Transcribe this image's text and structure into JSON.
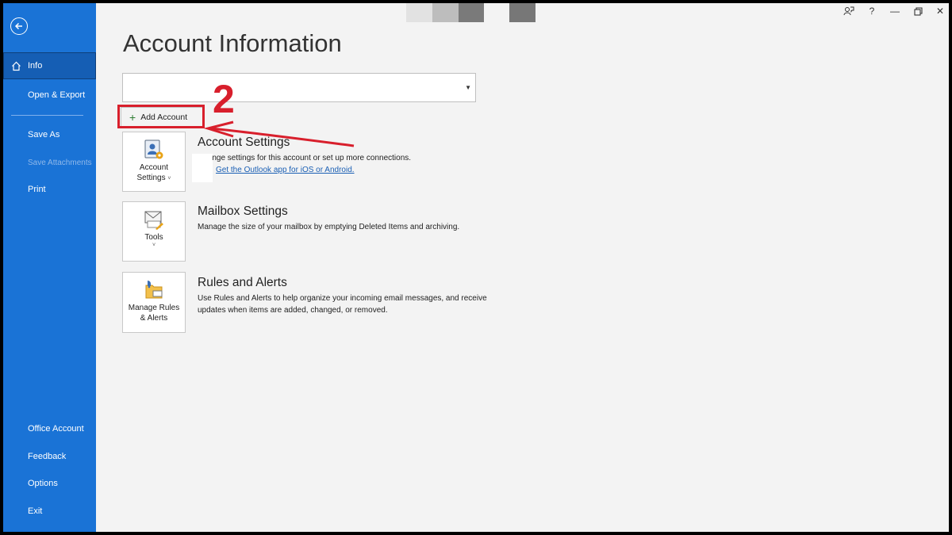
{
  "sidebar": {
    "items": [
      {
        "label": "Info"
      },
      {
        "label": "Open & Export"
      },
      {
        "label": "Save As"
      },
      {
        "label": "Save Attachments"
      },
      {
        "label": "Print"
      },
      {
        "label": "Office Account"
      },
      {
        "label": "Feedback"
      },
      {
        "label": "Options"
      },
      {
        "label": "Exit"
      }
    ]
  },
  "titlebar": {
    "icons": [
      "feedback-icon",
      "help-icon",
      "minimize-icon",
      "restore-icon",
      "close-icon"
    ],
    "help_glyph": "?",
    "minimize_glyph": "—",
    "close_glyph": "✕"
  },
  "main": {
    "title": "Account Information",
    "dropdown": {
      "value": ""
    },
    "add_account": {
      "plus": "+",
      "label": "Add Account"
    },
    "annotation": "2",
    "sections": [
      {
        "tile_label_1": "Account",
        "tile_label_2": "Settings",
        "tile_caret": "˅",
        "title": "Account Settings",
        "desc": "Change settings for this account or set up more connections.",
        "link": "Get the Outlook app for iOS or Android."
      },
      {
        "tile_label_1": "Tools",
        "tile_caret": "˅",
        "title": "Mailbox Settings",
        "desc": "Manage the size of your mailbox by emptying Deleted Items and archiving."
      },
      {
        "tile_label_1": "Manage Rules",
        "tile_label_2": "& Alerts",
        "title": "Rules and Alerts",
        "desc": "Use Rules and Alerts to help organize your incoming email messages, and receive updates when items are added, changed, or removed."
      }
    ]
  },
  "colors": {
    "sidebar": "#1a73d6",
    "annotation": "#d81f2c",
    "link": "#1a5fb4"
  }
}
